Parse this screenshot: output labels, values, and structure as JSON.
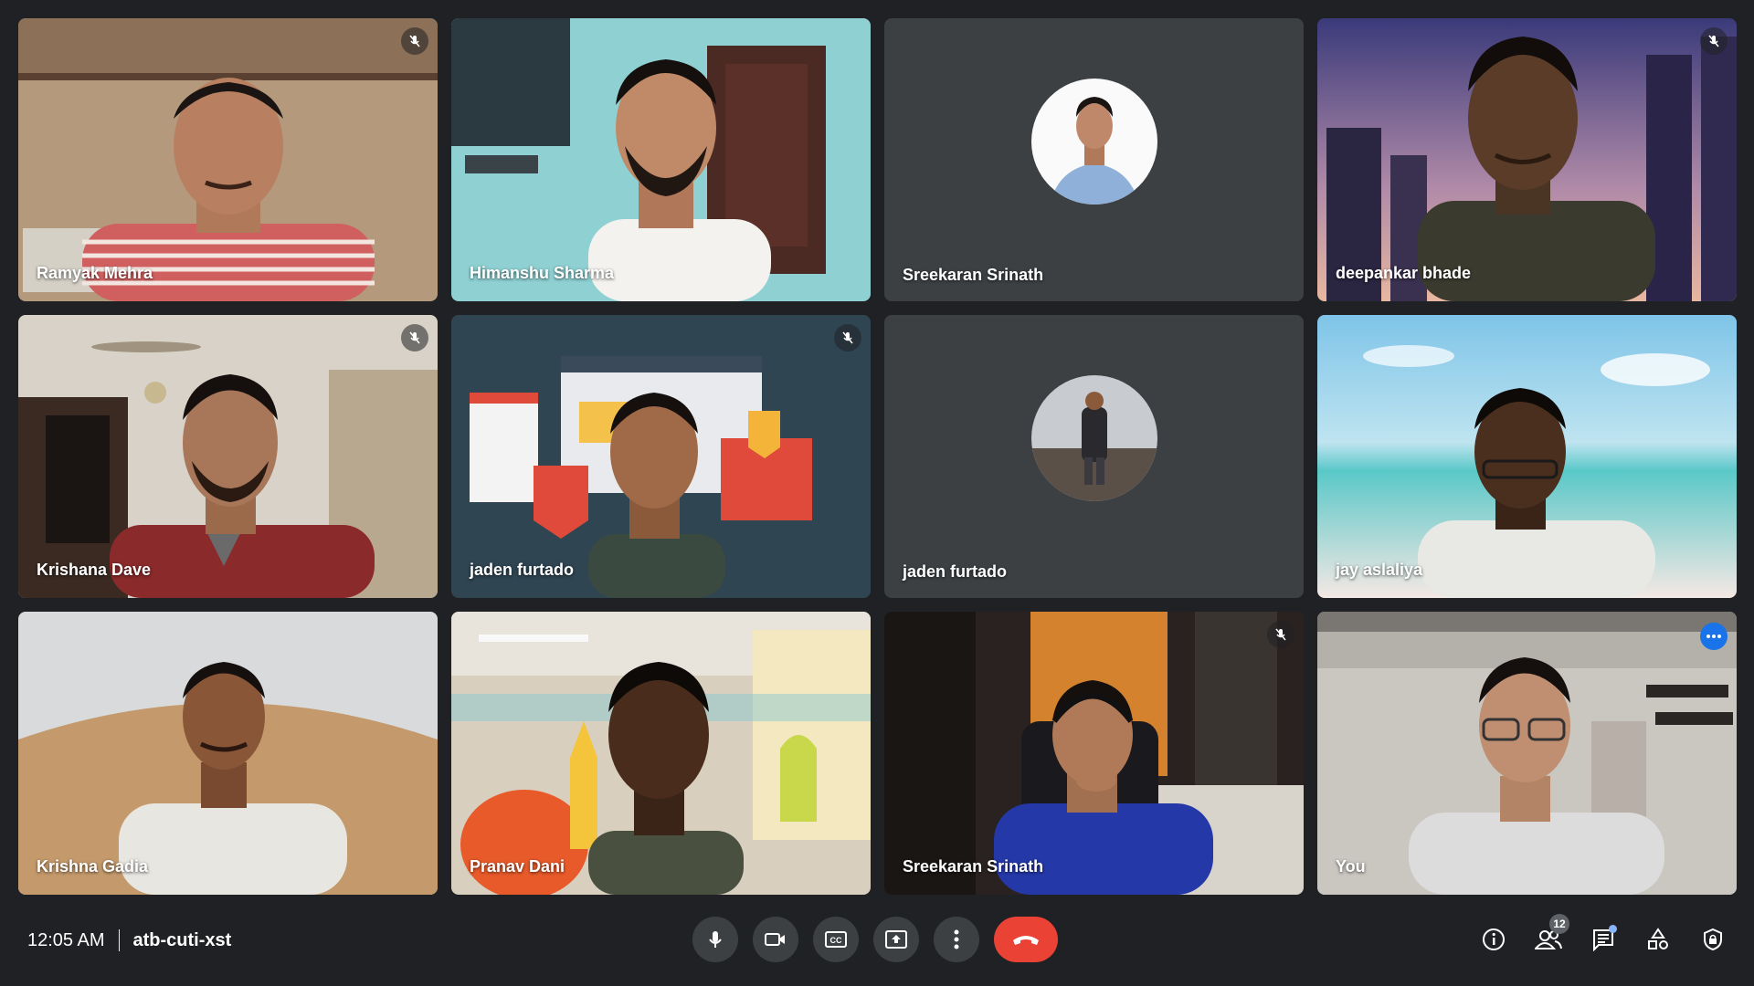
{
  "participants": [
    {
      "name": "Ramyak Mehra",
      "muted": true
    },
    {
      "name": "Himanshu Sharma",
      "muted": false
    },
    {
      "name": "Sreekaran Srinath",
      "muted": false,
      "camera_off": true
    },
    {
      "name": "deepankar bhade",
      "muted": true
    },
    {
      "name": "Krishana Dave",
      "muted": true
    },
    {
      "name": "jaden furtado",
      "muted": true
    },
    {
      "name": "jaden furtado",
      "muted": false,
      "camera_off": true
    },
    {
      "name": "jay aslaliya",
      "muted": false
    },
    {
      "name": "Krishna Gadia",
      "muted": false
    },
    {
      "name": "Pranav Dani",
      "muted": false
    },
    {
      "name": "Sreekaran Srinath",
      "muted": true
    },
    {
      "name": "You",
      "muted": false,
      "self": true
    }
  ],
  "meeting": {
    "time": "12:05 AM",
    "code": "atb-cuti-xst"
  },
  "controls": [
    "microphone-icon",
    "camera-icon",
    "captions-icon",
    "present-icon",
    "more-options-icon",
    "end-call-icon"
  ],
  "right_bar": {
    "participants_count": "12"
  },
  "colors": {
    "background": "#202124",
    "tile": "#3c4043",
    "end_call": "#ea4335",
    "self_border": "#8ab4f8",
    "accent": "#1a73e8"
  }
}
